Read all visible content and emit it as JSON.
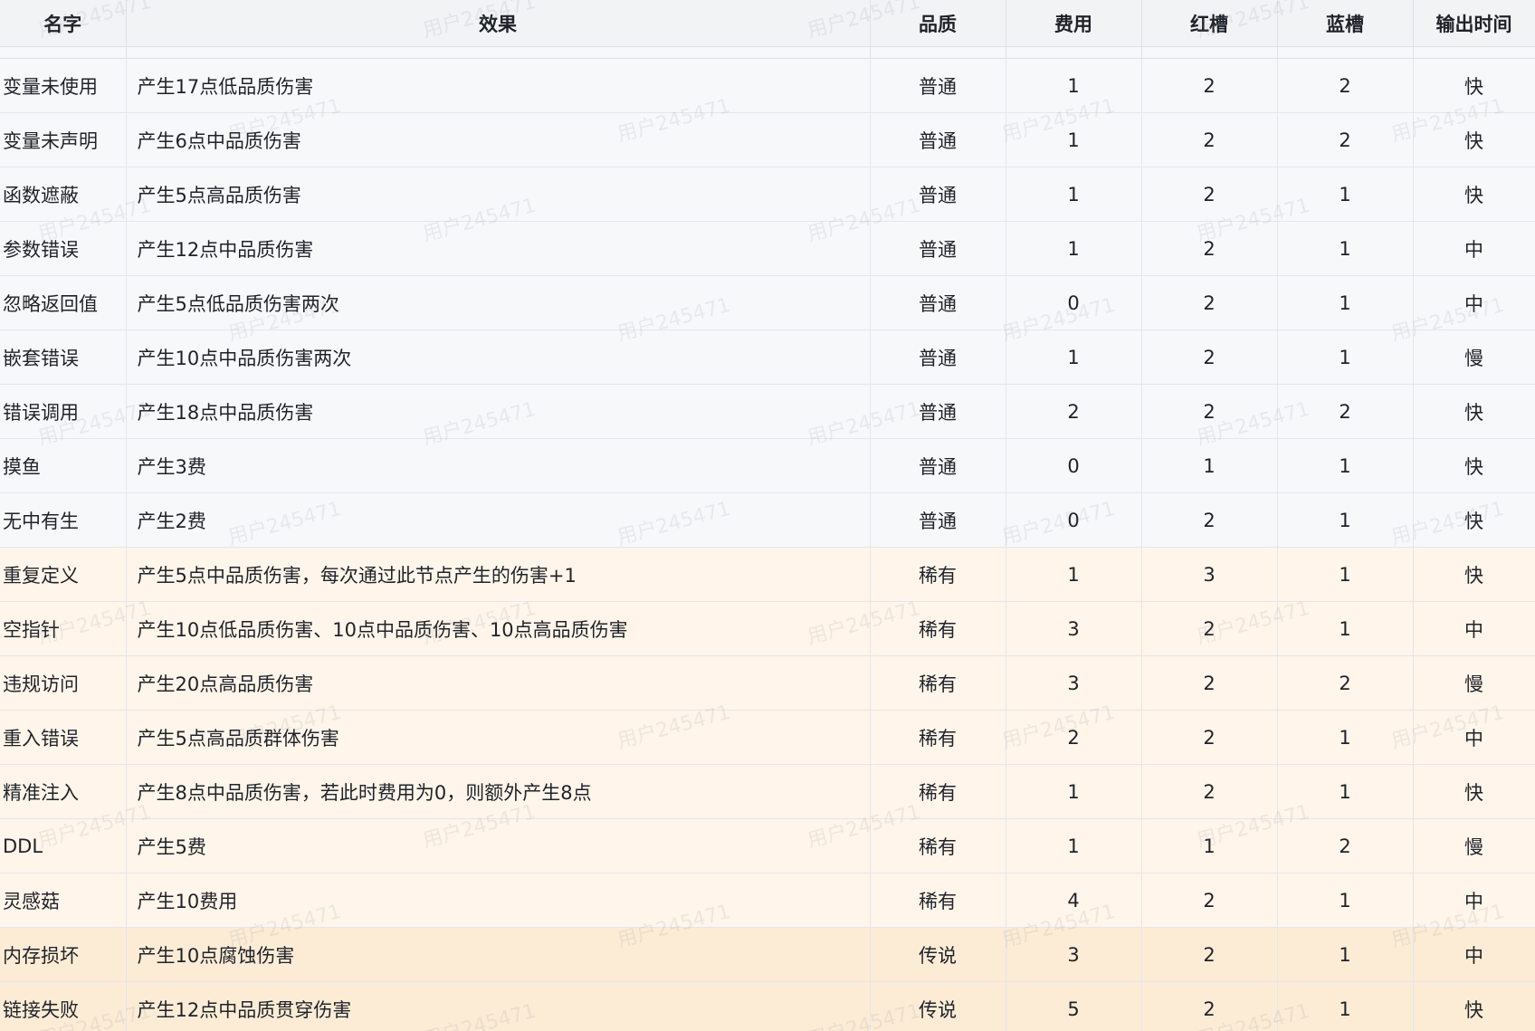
{
  "watermark": "用户245471",
  "headers": {
    "name": "名字",
    "effect": "效果",
    "quality": "品质",
    "cost": "费用",
    "red_slot": "红槽",
    "blue_slot": "蓝槽",
    "output_time": "输出时间"
  },
  "quality_colors": {
    "普通": "#f7f8fa",
    "稀有": "#fff5ea",
    "传说": "#fcecd6"
  },
  "rows": [
    {
      "name": "变量未使用",
      "effect": "产生17点低品质伤害",
      "quality": "普通",
      "cost": "1",
      "red": "2",
      "blue": "2",
      "time": "快"
    },
    {
      "name": "变量未声明",
      "effect": "产生6点中品质伤害",
      "quality": "普通",
      "cost": "1",
      "red": "2",
      "blue": "2",
      "time": "快"
    },
    {
      "name": "函数遮蔽",
      "effect": "产生5点高品质伤害",
      "quality": "普通",
      "cost": "1",
      "red": "2",
      "blue": "1",
      "time": "快"
    },
    {
      "name": "参数错误",
      "effect": "产生12点中品质伤害",
      "quality": "普通",
      "cost": "1",
      "red": "2",
      "blue": "1",
      "time": "中"
    },
    {
      "name": "忽略返回值",
      "effect": "产生5点低品质伤害两次",
      "quality": "普通",
      "cost": "0",
      "red": "2",
      "blue": "1",
      "time": "中"
    },
    {
      "name": "嵌套错误",
      "effect": "产生10点中品质伤害两次",
      "quality": "普通",
      "cost": "1",
      "red": "2",
      "blue": "1",
      "time": "慢"
    },
    {
      "name": "错误调用",
      "effect": "产生18点中品质伤害",
      "quality": "普通",
      "cost": "2",
      "red": "2",
      "blue": "2",
      "time": "快"
    },
    {
      "name": "摸鱼",
      "effect": "产生3费",
      "quality": "普通",
      "cost": "0",
      "red": "1",
      "blue": "1",
      "time": "快"
    },
    {
      "name": "无中有生",
      "effect": "产生2费",
      "quality": "普通",
      "cost": "0",
      "red": "2",
      "blue": "1",
      "time": "快"
    },
    {
      "name": "重复定义",
      "effect": "产生5点中品质伤害，每次通过此节点产生的伤害+1",
      "quality": "稀有",
      "cost": "1",
      "red": "3",
      "blue": "1",
      "time": "快"
    },
    {
      "name": "空指针",
      "effect": "产生10点低品质伤害、10点中品质伤害、10点高品质伤害",
      "quality": "稀有",
      "cost": "3",
      "red": "2",
      "blue": "1",
      "time": "中"
    },
    {
      "name": "违规访问",
      "effect": "产生20点高品质伤害",
      "quality": "稀有",
      "cost": "3",
      "red": "2",
      "blue": "2",
      "time": "慢"
    },
    {
      "name": "重入错误",
      "effect": "产生5点高品质群体伤害",
      "quality": "稀有",
      "cost": "2",
      "red": "2",
      "blue": "1",
      "time": "中"
    },
    {
      "name": "精准注入",
      "effect": "产生8点中品质伤害，若此时费用为0，则额外产生8点",
      "quality": "稀有",
      "cost": "1",
      "red": "2",
      "blue": "1",
      "time": "快"
    },
    {
      "name": "DDL",
      "effect": "产生5费",
      "quality": "稀有",
      "cost": "1",
      "red": "1",
      "blue": "2",
      "time": "慢"
    },
    {
      "name": "灵感菇",
      "effect": "产生10费用",
      "quality": "稀有",
      "cost": "4",
      "red": "2",
      "blue": "1",
      "time": "中"
    },
    {
      "name": "内存损坏",
      "effect": "产生10点腐蚀伤害",
      "quality": "传说",
      "cost": "3",
      "red": "2",
      "blue": "1",
      "time": "中"
    },
    {
      "name": "链接失败",
      "effect": "产生12点中品质贯穿伤害",
      "quality": "传说",
      "cost": "5",
      "red": "2",
      "blue": "1",
      "time": "快"
    }
  ]
}
